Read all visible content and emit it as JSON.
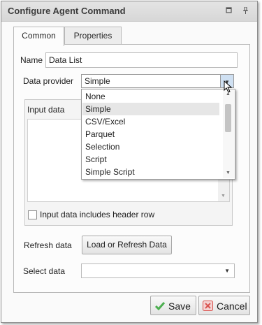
{
  "window": {
    "title": "Configure Agent Command"
  },
  "titlebar": {
    "icons": [
      "restore-icon",
      "pin-icon"
    ]
  },
  "tabs": [
    {
      "label": "Common",
      "active": true
    },
    {
      "label": "Properties",
      "active": false
    }
  ],
  "name_field": {
    "label": "Name",
    "value": "Data List"
  },
  "data_provider": {
    "label": "Data provider",
    "value": "Simple",
    "options": [
      "None",
      "Simple",
      "CSV/Excel",
      "Parquet",
      "Selection",
      "Script",
      "Simple Script"
    ],
    "selected_option": "Simple"
  },
  "input_data": {
    "label": "Input data",
    "value": ""
  },
  "header_row": {
    "label": "Input data includes header row",
    "checked": false
  },
  "refresh": {
    "label": "Refresh data",
    "button_label": "Load or Refresh Data"
  },
  "select_data": {
    "label": "Select data",
    "value": ""
  },
  "footer": {
    "save_label": "Save",
    "cancel_label": "Cancel"
  },
  "colors": {
    "save_check": "#4caf50",
    "cancel_x": "#d9534f"
  }
}
